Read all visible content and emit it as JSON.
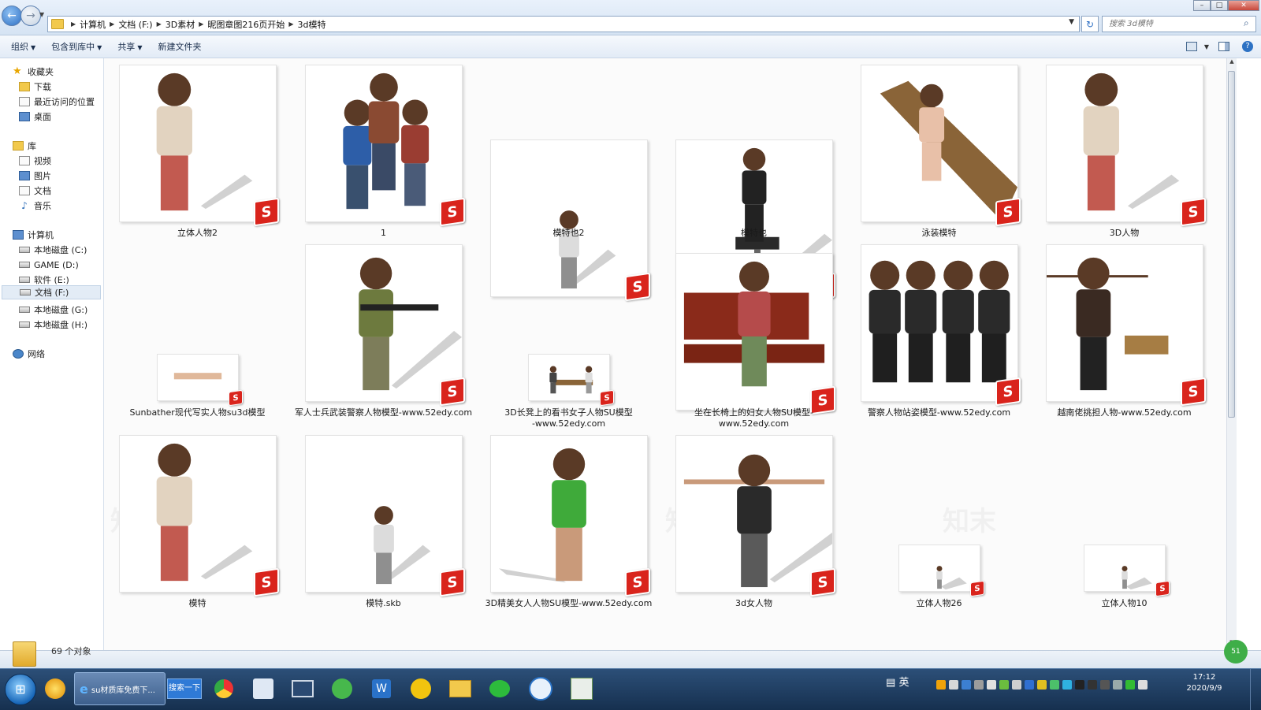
{
  "window": {
    "breadcrumb": [
      "计算机",
      "文档 (F:)",
      "3D素材",
      "昵图章图216页开始",
      "3d模特"
    ],
    "search_placeholder": "搜索 3d模特"
  },
  "toolbar": {
    "organize": "组织",
    "include_in_library": "包含到库中",
    "share": "共享",
    "new_folder": "新建文件夹"
  },
  "sidebar": {
    "favorites": {
      "label": "收藏夹",
      "items": [
        "下载",
        "最近访问的位置",
        "桌面"
      ]
    },
    "libraries": {
      "label": "库",
      "items": [
        "视频",
        "图片",
        "文档",
        "音乐"
      ]
    },
    "computer": {
      "label": "计算机",
      "items": [
        "本地磁盘 (C:)",
        "GAME (D:)",
        "软件 (E:)",
        "文档 (F:)",
        "本地磁盘 (G:)",
        "本地磁盘 (H:)"
      ],
      "selected": "文档 (F:)"
    },
    "network": {
      "label": "网络"
    }
  },
  "files": [
    {
      "name": "立体人物2"
    },
    {
      "name": "1"
    },
    {
      "name": "模特也2"
    },
    {
      "name": "模特也"
    },
    {
      "name": "泳装模特"
    },
    {
      "name": "3D人物"
    },
    {
      "name": "Sunbather现代写实人物su3d模型"
    },
    {
      "name": "军人士兵武装警察人物模型-www.52edy.com"
    },
    {
      "name": "3D长凳上的看书女子人物SU模型-www.52edy.com",
      "lines": [
        "3D长凳上的看书女子人物SU模型",
        "-www.52edy.com"
      ]
    },
    {
      "name": "坐在长椅上的妇女人物SU模型-www.52edy.com"
    },
    {
      "name": "警察人物站姿模型-www.52edy.com"
    },
    {
      "name": "越南佬挑担人物-www.52edy.com"
    },
    {
      "name": "模特"
    },
    {
      "name": "模特.skb"
    },
    {
      "name": "3D精美女人人物SU模型-www.52edy.com"
    },
    {
      "name": "3d女人物"
    },
    {
      "name": "立体人物26"
    },
    {
      "name": "立体人物10"
    }
  ],
  "status": {
    "count_text": "69 个对象"
  },
  "taskbar": {
    "active_task": "su材质库免费下...",
    "search_button": "搜索一下",
    "ime": "英",
    "time": "17:12",
    "date": "2020/9/9"
  },
  "side_badge": "51",
  "colors": {
    "su_badge": "#d9241c",
    "accent": "#2c6fc4"
  }
}
